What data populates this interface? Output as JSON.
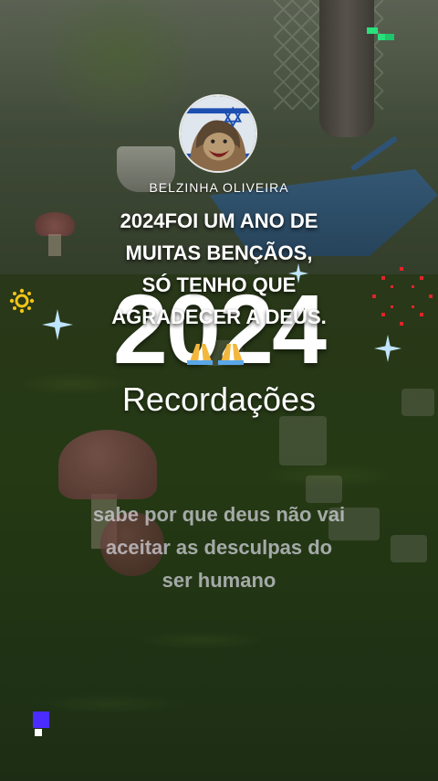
{
  "profile": {
    "name": "BELZINHA  OLIVEIRA",
    "avatar_icon": "lion-israel-flag-avatar"
  },
  "post": {
    "caption_lines": [
      "2024FOI UM ANO DE",
      "MUITAS BENÇÃOS,",
      "SÓ TENHO QUE",
      "AGRADECER A DEUS."
    ],
    "emoji": "🙏🙏",
    "quote_lines": [
      "sabe por que deus não vai",
      "aceitar as desculpas do",
      "ser humano"
    ]
  },
  "overlay": {
    "year": "2024",
    "subtitle": "Recordações"
  },
  "colors": {
    "text": "#ffffff",
    "sparkle": "#bfe4ff",
    "fireworks": "#e0242a",
    "sun": "#f2c418",
    "corner_tr": "#29e07a",
    "corner_bl": "#4b2cff"
  }
}
